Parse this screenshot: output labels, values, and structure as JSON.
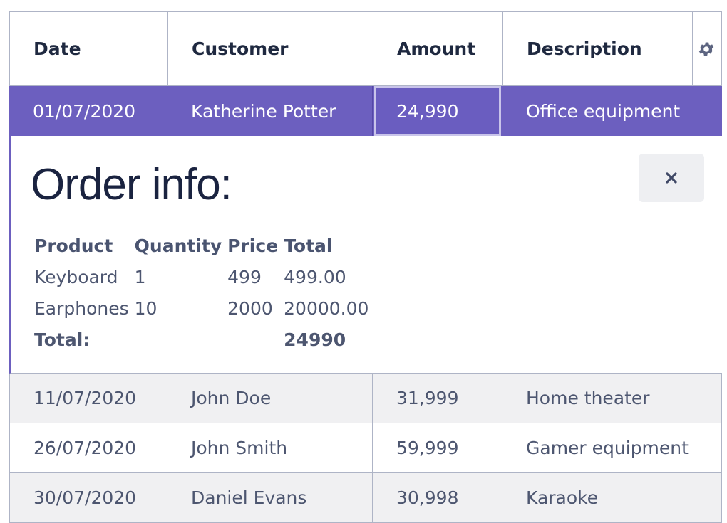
{
  "columns": {
    "date": "Date",
    "customer": "Customer",
    "amount": "Amount",
    "description": "Description",
    "settings_icon": "gear-icon"
  },
  "selected_row": {
    "date": "01/07/2020",
    "customer": "Katherine Potter",
    "amount": "24,990",
    "description": "Office equipment"
  },
  "order_info": {
    "title": "Order info:",
    "close_icon": "close-icon",
    "headers": [
      "Product",
      "Quantity",
      "Price",
      "Total"
    ],
    "items": [
      {
        "product": "Keyboard",
        "quantity": "1",
        "price": "499",
        "total": "499.00"
      },
      {
        "product": "Earphones",
        "quantity": "10",
        "price": "2000",
        "total": "20000.00"
      }
    ],
    "total_label": "Total:",
    "total_value": "24990"
  },
  "rows": [
    {
      "date": "11/07/2020",
      "customer": "John Doe",
      "amount": "31,999",
      "description": "Home theater"
    },
    {
      "date": "26/07/2020",
      "customer": "John Smith",
      "amount": "59,999",
      "description": "Gamer equipment"
    },
    {
      "date": "30/07/2020",
      "customer": "Daniel Evans",
      "amount": "30,998",
      "description": "Karaoke"
    }
  ],
  "colors": {
    "accent": "#6c5fbf",
    "border": "#aeb4c6",
    "row_alt": "#f0f0f2",
    "text": "#4d5670",
    "header_text": "#1f2940"
  }
}
